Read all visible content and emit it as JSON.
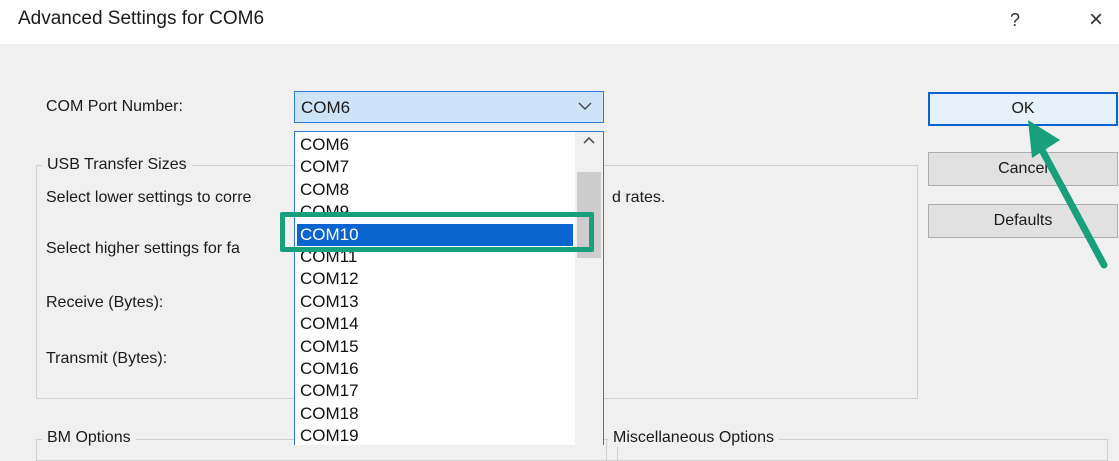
{
  "window": {
    "title": "Advanced Settings for COM6",
    "help_label": "?",
    "close_label": "×"
  },
  "labels": {
    "com_port_number": "COM Port Number:",
    "usb_transfer_sizes": "USB Transfer Sizes",
    "select_lower": "Select lower settings to corre",
    "select_lower_tail": "d rates.",
    "select_higher": "Select higher settings for fa",
    "receive": "Receive (Bytes):",
    "transmit": "Transmit (Bytes):",
    "bm_options": "BM Options",
    "misc_options": "Miscellaneous Options"
  },
  "combo": {
    "value": "COM6",
    "arrow_icon": "chevron-down-icon"
  },
  "dropdown": {
    "options": [
      "COM6",
      "COM7",
      "COM8",
      "COM9",
      "COM10",
      "COM11",
      "COM12",
      "COM13",
      "COM14",
      "COM15",
      "COM16",
      "COM17",
      "COM18",
      "COM19"
    ],
    "selected": "COM10"
  },
  "buttons": {
    "ok": "OK",
    "cancel": "Cancel",
    "defaults": "Defaults"
  },
  "annotation": {
    "highlight_color": "#17a07b",
    "selection_color": "#0a64d0"
  }
}
